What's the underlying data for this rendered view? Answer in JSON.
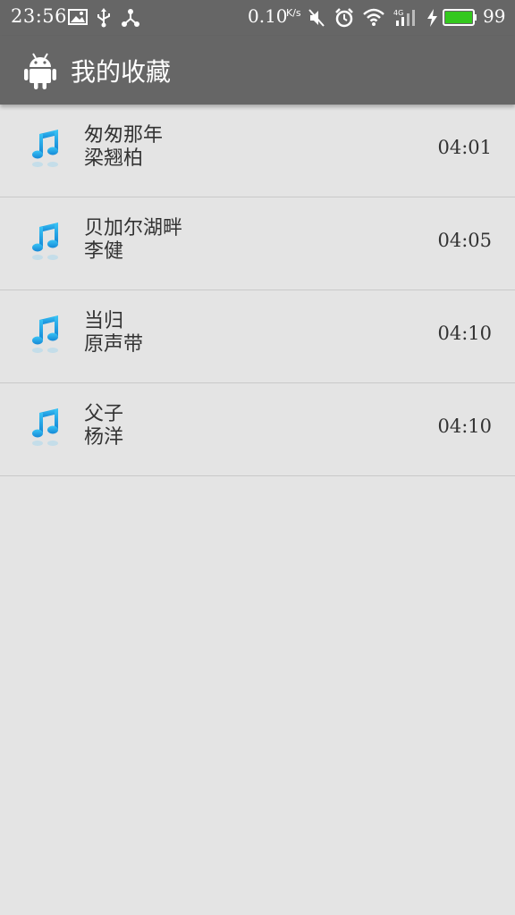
{
  "status_bar": {
    "time": "23:56",
    "net_speed": "0.10",
    "net_speed_unit": "K/s",
    "battery_level": "99",
    "icons": [
      "image-icon",
      "usb-icon",
      "share-icon",
      "mute-icon",
      "alarm-icon",
      "wifi-icon",
      "4g-signal-icon",
      "charging-icon",
      "battery-icon"
    ],
    "battery_color": "#34c81e"
  },
  "app_bar": {
    "title": "我的收藏",
    "logo": "android-icon"
  },
  "colors": {
    "bar_background": "#666666",
    "page_background": "#e4e4e4",
    "note_icon": "#1aa9e8"
  },
  "favorites": [
    {
      "title": "匆匆那年",
      "artist": "梁翘柏",
      "duration": "04:01",
      "icon": "music-note-icon"
    },
    {
      "title": "贝加尔湖畔",
      "artist": "李健",
      "duration": "04:05",
      "icon": "music-note-icon"
    },
    {
      "title": "当归",
      "artist": "原声带",
      "duration": "04:10",
      "icon": "music-note-icon"
    },
    {
      "title": "父子",
      "artist": "杨洋",
      "duration": "04:10",
      "icon": "music-note-icon"
    }
  ]
}
